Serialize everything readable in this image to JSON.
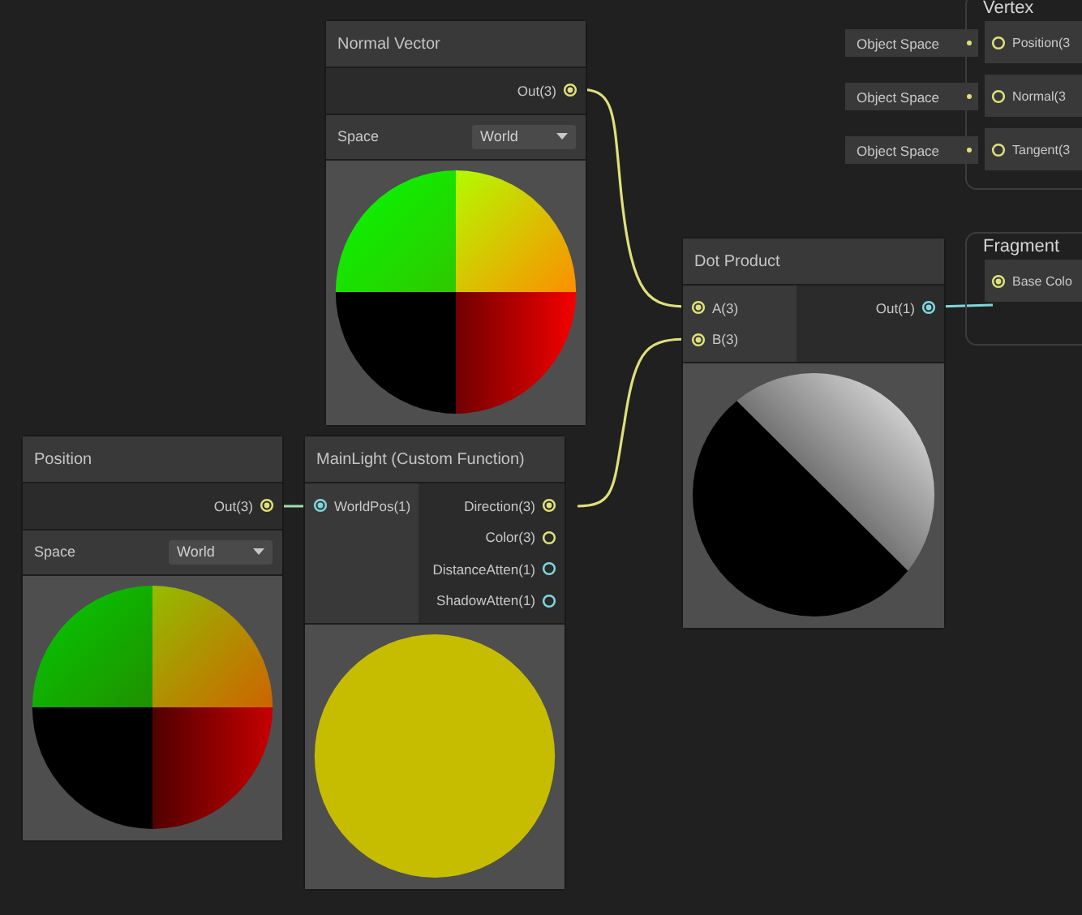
{
  "nodes": [
    {
      "title": "Normal Vector",
      "outputs": [
        {
          "name": "Out(3)",
          "color": "#dfe07a",
          "connected": true
        }
      ],
      "control": {
        "label": "Space",
        "value": "World"
      },
      "preview": {
        "kind": "normal_sphere"
      }
    },
    {
      "title": "Dot Product",
      "inputs": [
        {
          "name": "A(3)",
          "color": "#dfe07a",
          "connected": true
        },
        {
          "name": "B(3)",
          "color": "#dfe07a",
          "connected": true
        }
      ],
      "outputs": [
        {
          "name": "Out(1)",
          "color": "#7fd6dc",
          "connected": true
        }
      ],
      "preview": {
        "kind": "dot_sphere"
      }
    },
    {
      "title": "Position",
      "outputs": [
        {
          "name": "Out(3)",
          "color": "#dfe07a",
          "connected": true
        }
      ],
      "control": {
        "label": "Space",
        "value": "World"
      },
      "preview": {
        "kind": "position_sphere"
      }
    },
    {
      "title": "MainLight (Custom Function)",
      "inputs": [
        {
          "name": "WorldPos(1)",
          "color": "#7fd6dc",
          "connected": true
        }
      ],
      "outputs": [
        {
          "name": "Direction(3)",
          "color": "#dfe07a",
          "connected": true
        },
        {
          "name": "Color(3)",
          "color": "#dfe07a",
          "connected": false
        },
        {
          "name": "DistanceAtten(1)",
          "color": "#7fd6dc",
          "connected": false
        },
        {
          "name": "ShadowAtten(1)",
          "color": "#7fd6dc",
          "connected": false
        }
      ],
      "preview": {
        "kind": "solid_sphere"
      }
    }
  ],
  "contexts": [
    {
      "title": "Vertex",
      "blocks": [
        {
          "name": "Position(3",
          "color": "#dfe07a",
          "connected": false,
          "property": "Object Space"
        },
        {
          "name": "Normal(3",
          "color": "#dfe07a",
          "connected": false,
          "property": "Object Space"
        },
        {
          "name": "Tangent(3",
          "color": "#dfe07a",
          "connected": false,
          "property": "Object Space"
        }
      ]
    },
    {
      "title": "Fragment",
      "blocks": [
        {
          "name": "Base Colo",
          "color": "#dfe07a",
          "connected": true
        }
      ]
    }
  ]
}
